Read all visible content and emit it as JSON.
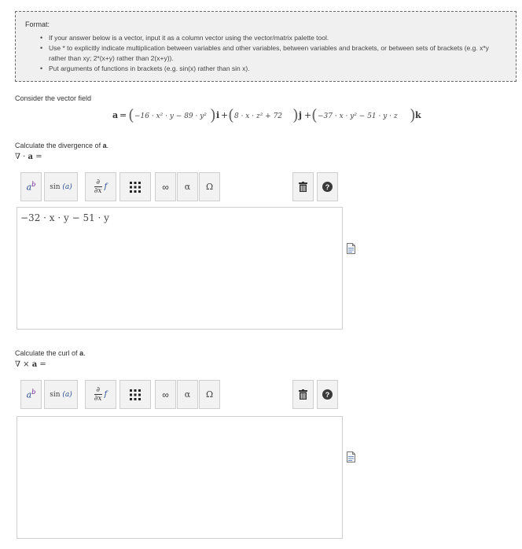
{
  "format": {
    "title": "Format:",
    "items": [
      "If your answer below is a vector, input it as a column vector using the vector/matrix palette tool.",
      "Use * to explicitly indicate multiplication between variables and other variables, between variables and brackets, or between sets of brackets (e.g. x*y rather than xy; 2*(x+y) rather than 2(x+y)).",
      "Put arguments of functions in brackets (e.g. sin(x) rather than sin x)."
    ]
  },
  "intro": "Consider the vector field",
  "field": {
    "lhs": "a",
    "eq": "=",
    "i_comp": "−16 · x² · y − 89 · y²",
    "j_comp": "8 · x · z² + 72",
    "k_comp": "−37 · x · y² − 51 · y · z",
    "i": "i",
    "j": "j",
    "k": "k"
  },
  "q1": {
    "prompt": "Calculate the divergence of",
    "prompt_var": "a",
    "prompt_end": ".",
    "label_op": "∇ ·",
    "label_var": "a",
    "label_eq": "=",
    "answer": "−32 · x · y − 51 · y"
  },
  "q2": {
    "prompt": "Calculate the curl of",
    "prompt_var": "a",
    "prompt_end": ".",
    "label_op": "∇ ×",
    "label_var": "a",
    "label_eq": "=",
    "answer": ""
  },
  "toolbar": {
    "power_base": "a",
    "power_exp": "b",
    "sin_label": "sin",
    "sin_arg": "(a)",
    "partial_num": "∂",
    "partial_den": "∂x",
    "partial_f": "f",
    "infinity": "∞",
    "alpha": "α",
    "omega": "Ω",
    "help": "?",
    "icons": [
      "power-icon",
      "trig-function-icon",
      "partial-derivative-icon",
      "matrix-icon",
      "infinity-icon",
      "greek-lower-icon",
      "greek-upper-icon",
      "trash-icon",
      "help-icon",
      "preview-icon"
    ]
  }
}
